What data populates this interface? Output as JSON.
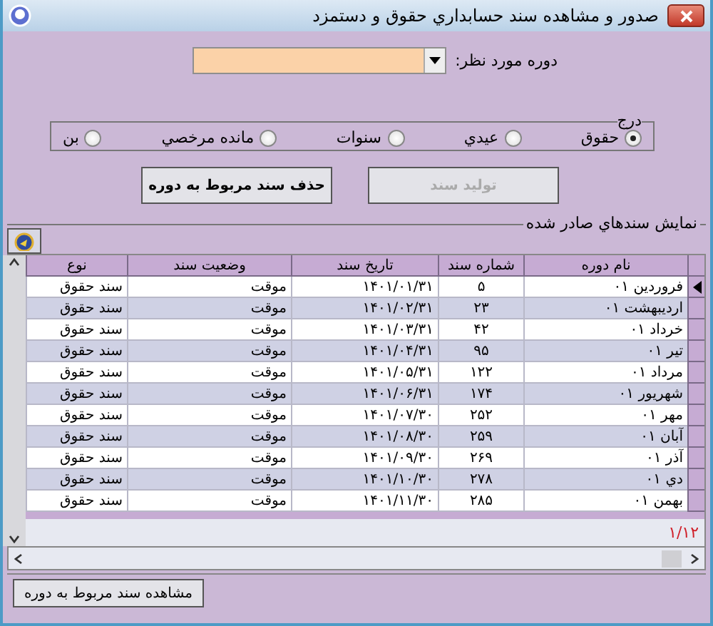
{
  "window": {
    "title": "صدور و مشاهده سند حسابداري حقوق و دستمزد"
  },
  "period": {
    "label": "دوره مورد نظر:"
  },
  "insert_group": {
    "legend": "درج",
    "options": [
      {
        "label": "حقوق",
        "selected": true
      },
      {
        "label": "عيدي",
        "selected": false
      },
      {
        "label": "سنوات",
        "selected": false
      },
      {
        "label": "مانده مرخصي",
        "selected": false
      },
      {
        "label": "بن",
        "selected": false
      }
    ]
  },
  "actions": [
    {
      "label": "توليد سند",
      "disabled": true
    },
    {
      "label": "حذف سند مربوط به دوره",
      "disabled": false
    }
  ],
  "issued": {
    "legend": "نمايش سندهاي صادر شده",
    "columns": [
      "نام دوره",
      "شماره سند",
      "تاريخ سند",
      "وضعيت سند",
      "نوع"
    ],
    "rows": [
      {
        "cells": [
          "فروردين ۰۱",
          "۵",
          "۱۴۰۱/۰۱/۳۱",
          "موقت",
          "سند حقوق"
        ],
        "selected": true
      },
      {
        "cells": [
          "ارديبهشت ۰۱",
          "۲۳",
          "۱۴۰۱/۰۲/۳۱",
          "موقت",
          "سند حقوق"
        ],
        "selected": false
      },
      {
        "cells": [
          "خرداد ۰۱",
          "۴۲",
          "۱۴۰۱/۰۳/۳۱",
          "موقت",
          "سند حقوق"
        ],
        "selected": false
      },
      {
        "cells": [
          "تير ۰۱",
          "۹۵",
          "۱۴۰۱/۰۴/۳۱",
          "موقت",
          "سند حقوق"
        ],
        "selected": false
      },
      {
        "cells": [
          "مرداد ۰۱",
          "۱۲۲",
          "۱۴۰۱/۰۵/۳۱",
          "موقت",
          "سند حقوق"
        ],
        "selected": false
      },
      {
        "cells": [
          "شهريور ۰۱",
          "۱۷۴",
          "۱۴۰۱/۰۶/۳۱",
          "موقت",
          "سند حقوق"
        ],
        "selected": false
      },
      {
        "cells": [
          "مهر ۰۱",
          "۲۵۲",
          "۱۴۰۱/۰۷/۳۰",
          "موقت",
          "سند حقوق"
        ],
        "selected": false
      },
      {
        "cells": [
          "آبان ۰۱",
          "۲۵۹",
          "۱۴۰۱/۰۸/۳۰",
          "موقت",
          "سند حقوق"
        ],
        "selected": false
      },
      {
        "cells": [
          "آذر ۰۱",
          "۲۶۹",
          "۱۴۰۱/۰۹/۳۰",
          "موقت",
          "سند حقوق"
        ],
        "selected": false
      },
      {
        "cells": [
          "دي ۰۱",
          "۲۷۸",
          "۱۴۰۱/۱۰/۳۰",
          "موقت",
          "سند حقوق"
        ],
        "selected": false
      },
      {
        "cells": [
          "بهمن ۰۱",
          "۲۸۵",
          "۱۴۰۱/۱۱/۳۰",
          "موقت",
          "سند حقوق"
        ],
        "selected": false
      }
    ],
    "counter": "۱/۱۲"
  },
  "footer_button": "مشاهده سند مربوط به دوره"
}
